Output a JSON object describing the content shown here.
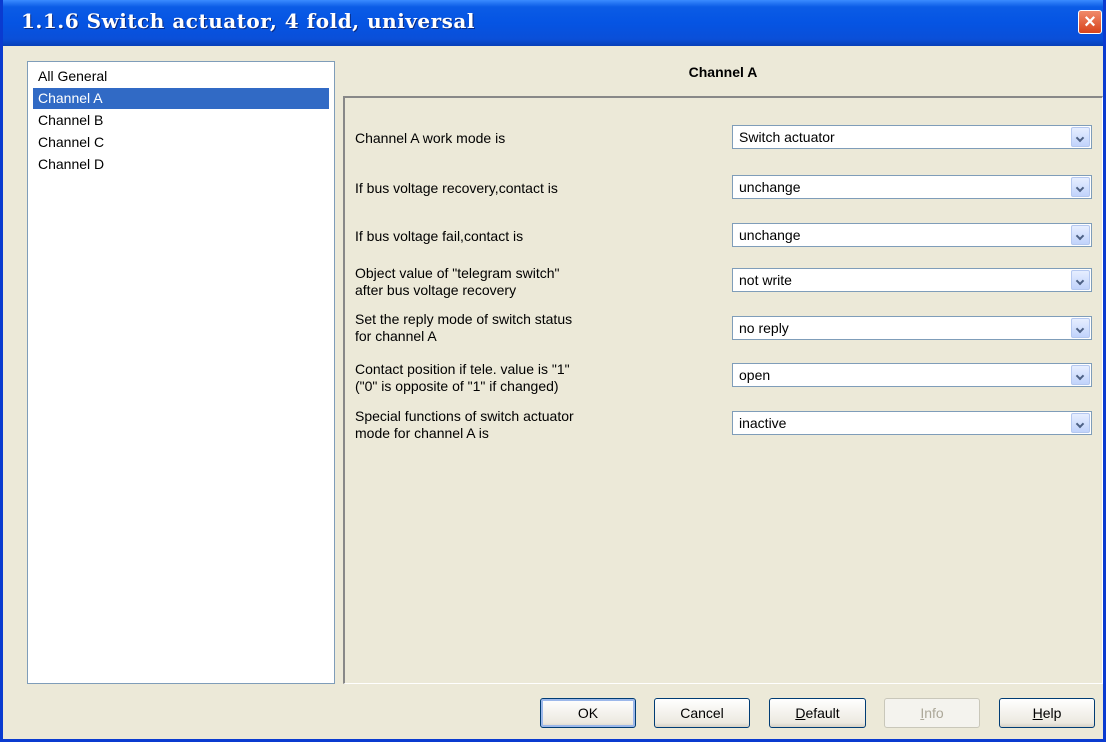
{
  "window": {
    "title": "1.1.6 Switch actuator, 4 fold, universal"
  },
  "sidebar": {
    "items": [
      {
        "label": "All General",
        "selected": false
      },
      {
        "label": "Channel A",
        "selected": true
      },
      {
        "label": "Channel B",
        "selected": false
      },
      {
        "label": "Channel C",
        "selected": false
      },
      {
        "label": "Channel D",
        "selected": false
      }
    ]
  },
  "panel": {
    "title": "Channel A",
    "params": [
      {
        "label": "Channel A work mode is",
        "value": "Switch actuator"
      },
      {
        "label": "If bus voltage recovery,contact is",
        "value": "unchange"
      },
      {
        "label": "If bus voltage fail,contact is",
        "value": "unchange"
      },
      {
        "label_line1": "Object value of \"telegram switch\"",
        "label_line2": "after bus voltage recovery",
        "value": "not write"
      },
      {
        "label_line1": "Set the reply mode of switch status",
        "label_line2": "for channel A",
        "value": "no reply"
      },
      {
        "label_line1": "Contact position if tele. value is \"1\"",
        "label_line2": " (\"0\" is opposite of \"1\" if changed)",
        "value": "open"
      },
      {
        "label_line1": "Special functions of switch actuator",
        "label_line2": " mode for channel A is",
        "value": "inactive"
      }
    ]
  },
  "buttons": {
    "ok": "OK",
    "cancel": "Cancel",
    "default_first": "D",
    "default_rest": "efault",
    "info_first": "I",
    "info_rest": "nfo",
    "help_first": "H",
    "help_rest": "elp"
  },
  "colors": {
    "titlebar": "#0554e3",
    "selection": "#316ac5",
    "dialog_bg": "#ece9d8"
  }
}
